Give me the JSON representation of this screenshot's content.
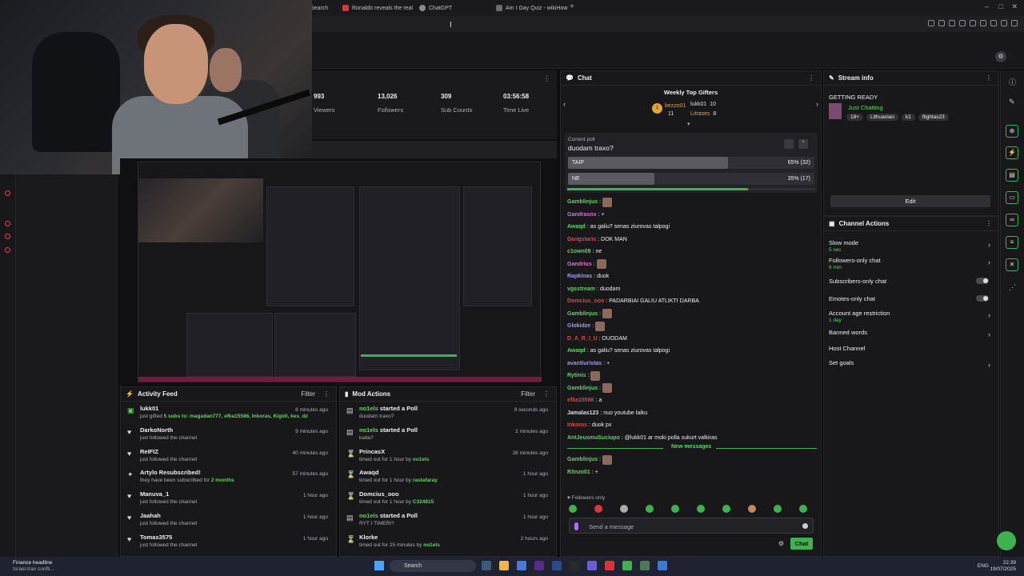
{
  "browser": {
    "tabs": [
      {
        "label": "Search",
        "color": "#3a3a40"
      },
      {
        "label": "Ronaldo reveals the real",
        "color": "#d9343c"
      },
      {
        "label": "ChatGPT",
        "color": "#8a8a90"
      },
      {
        "label": "Am I Gay Quiz - wikiHow",
        "color": "#6b6b70"
      }
    ],
    "new_tab": "+"
  },
  "stats": [
    {
      "num": "993",
      "label": "Viewers"
    },
    {
      "num": "13,026",
      "label": "Followers"
    },
    {
      "num": "309",
      "label": "Sub Counts"
    },
    {
      "num": "03:56:58",
      "label": "Time Live"
    }
  ],
  "activity_feed": {
    "title": "Activity Feed",
    "filter": "Filter",
    "items": [
      {
        "name": "lukk01",
        "desc_prefix": "just gifted ",
        "desc_hl": "5 subs to: magadan777, efka15586, Inkoras, Kigidi, kes_dz",
        "time": "8 minutes ago",
        "icon": "gift-icon"
      },
      {
        "name": "DarkoNorth",
        "desc_prefix": "just followed the channel",
        "desc_hl": "",
        "time": "9 minutes ago",
        "icon": "heart-icon"
      },
      {
        "name": "ReIFIZ",
        "desc_prefix": "just followed the channel",
        "desc_hl": "",
        "time": "40 minutes ago",
        "icon": "heart-icon"
      },
      {
        "name": "Artylo Resubscribed!",
        "desc_prefix": "they have been subscribed for ",
        "desc_hl": "2 months",
        "time": "57 minutes ago",
        "icon": "star-icon"
      },
      {
        "name": "Manuva_1",
        "desc_prefix": "just followed the channel",
        "desc_hl": "",
        "time": "1 hour ago",
        "icon": "heart-icon"
      },
      {
        "name": "Jaahah",
        "desc_prefix": "just followed the channel",
        "desc_hl": "",
        "time": "1 hour ago",
        "icon": "heart-icon"
      },
      {
        "name": "Tomas3575",
        "desc_prefix": "just followed the channel",
        "desc_hl": "",
        "time": "1 hour ago",
        "icon": "heart-icon"
      }
    ]
  },
  "mod_actions": {
    "title": "Mod Actions",
    "filter": "Filter",
    "items": [
      {
        "name_hl": "no1els",
        "name_rest": " started a Poll",
        "desc": "duodam traxo?",
        "desc_hl": "",
        "time": "9 seconds ago",
        "icon": "poll-icon"
      },
      {
        "name_hl": "no1els",
        "name_rest": " started a Poll",
        "desc": "kada?",
        "desc_hl": "",
        "time": "2 minutes ago",
        "icon": "poll-icon"
      },
      {
        "name_hl": "",
        "name_rest": "PrincasX",
        "desc": "timed out for 1 hour by ",
        "desc_hl": "no1els",
        "time": "38 minutes ago",
        "icon": "hourglass-icon"
      },
      {
        "name_hl": "",
        "name_rest": "Awaqd",
        "desc": "timed out for 1 hour by ",
        "desc_hl": "rastafaray",
        "time": "1 hour ago",
        "icon": "hourglass-icon"
      },
      {
        "name_hl": "",
        "name_rest": "Domcius_ooo",
        "desc": "timed out for 1 hour by ",
        "desc_hl": "C324815",
        "time": "1 hour ago",
        "icon": "hourglass-icon"
      },
      {
        "name_hl": "no1els",
        "name_rest": " started a Poll",
        "desc": "RYT I TIMERI?",
        "desc_hl": "",
        "time": "1 hour ago",
        "icon": "poll-icon"
      },
      {
        "name_hl": "",
        "name_rest": "Klorke",
        "desc": "timed out for 25 minutes by ",
        "desc_hl": "no1els",
        "time": "2 hours ago",
        "icon": "hourglass-icon"
      }
    ]
  },
  "chat": {
    "title": "Chat",
    "gifters_title": "Weekly Top Gifters",
    "gifters": [
      {
        "name": "bezzo01",
        "count": "11",
        "color": "#e0a43a"
      },
      {
        "name": "lukk01",
        "count": "10",
        "color": "#dedee3"
      },
      {
        "name": "Litrases",
        "count": "8",
        "color": "#e0a43a"
      }
    ],
    "poll": {
      "label": "Current poll",
      "question": "duodam traxo?",
      "options": [
        {
          "label": "TAIP",
          "value": "65% (32)",
          "pct": 65
        },
        {
          "label": "NE",
          "value": "35% (17)",
          "pct": 35
        }
      ],
      "progress_pct": 73
    },
    "messages": [
      {
        "user": "Gamblinjus",
        "color": "#5fd35f",
        "text": "",
        "emote": true
      },
      {
        "user": "Gandrasnx",
        "color": "#e06bd0",
        "text": " +",
        "emote": false
      },
      {
        "user": "Awaqd",
        "color": "#5fd35f",
        "text": " as galiu? senas ziurovas talpogi",
        "emote": false
      },
      {
        "user": "Dangstaris",
        "color": "#e04444",
        "text": " DOK MAN",
        "emote": false
      },
      {
        "user": "c1own09",
        "color": "#5fd35f",
        "text": " ne",
        "emote": false
      },
      {
        "user": "Gandrius",
        "color": "#e06bd0",
        "text": "",
        "emote": true
      },
      {
        "user": "Rapkinas",
        "color": "#9a9aff",
        "text": " duok",
        "emote": false
      },
      {
        "user": "vgsstream",
        "color": "#5fd35f",
        "text": " duodam",
        "emote": false
      },
      {
        "user": "Domcius_ooo",
        "color": "#e04444",
        "text": " PADARBIAI GALIU ATLIKTI DARBA",
        "emote": false
      },
      {
        "user": "Gamblinjus",
        "color": "#5fd35f",
        "text": "",
        "emote": true
      },
      {
        "user": "Glokidze",
        "color": "#9a9aff",
        "text": "",
        "emote": true
      },
      {
        "user": "D_A_R_I_U",
        "color": "#e04444",
        "text": " DUODAM",
        "emote": false
      },
      {
        "user": "Awaqd",
        "color": "#5fd35f",
        "text": " as galiu? senas ziurovas talpogi",
        "emote": false
      },
      {
        "user": "avantiuristas",
        "color": "#9a9aff",
        "text": " +",
        "emote": false
      },
      {
        "user": "Rytinis",
        "color": "#5fd35f",
        "text": "",
        "emote": true
      },
      {
        "user": "Gamblinjus",
        "color": "#5fd35f",
        "text": "",
        "emote": true
      },
      {
        "user": "efka15586",
        "color": "#e04444",
        "text": " a",
        "emote": false
      },
      {
        "user": "Jamalas123",
        "color": "#dedee3",
        "text": " nuo youtube laiku",
        "emote": false
      },
      {
        "user": "Inkoras",
        "color": "#e04444",
        "text": " duok px",
        "emote": false
      },
      {
        "user": "AntJeusmuSuciupo",
        "color": "#5fd35f",
        "text": " @lukk01 ar moki polla sukurt valkiras",
        "emote": false
      }
    ],
    "new_messages": "New messages",
    "messages2": [
      {
        "user": "Gamblinjus",
        "color": "#5fd35f",
        "text": "",
        "emote": true
      },
      {
        "user": "R3nzo01",
        "color": "#5fd35f",
        "text": " +",
        "emote": false
      }
    ],
    "followers_only": "Followers only",
    "input_placeholder": "Send a message",
    "send": "Chat"
  },
  "stream_info": {
    "title": "Stream info",
    "stream_title": "GETTING READY",
    "category": "Just Chatting",
    "tags": [
      "18+",
      "Lithuanian",
      "k1",
      "flightas23"
    ],
    "edit": "Edit"
  },
  "channel_actions": {
    "title": "Channel Actions",
    "items": [
      {
        "label": "Slow mode",
        "sub": "5 sec",
        "kind": "chevron"
      },
      {
        "label": "Followers-only chat",
        "sub": "6 min",
        "kind": "chevron"
      },
      {
        "label": "Subscribers-only chat",
        "sub": "",
        "kind": "toggle"
      },
      {
        "label": "Emotes-only chat",
        "sub": "",
        "kind": "toggle"
      },
      {
        "label": "Account age restriction",
        "sub": "1 day",
        "kind": "chevron"
      },
      {
        "label": "Banned words",
        "sub": "",
        "kind": "chevron"
      },
      {
        "label": "Host Channel",
        "sub": "",
        "kind": "none"
      },
      {
        "label": "Set goals",
        "sub": "",
        "kind": "chevron"
      }
    ]
  },
  "taskbar": {
    "news_title": "Finance headline",
    "news_sub": "Israel-Iran confli...",
    "search": "Search",
    "lang": "ENG",
    "time": "22:39",
    "date": "19/07/2025"
  }
}
